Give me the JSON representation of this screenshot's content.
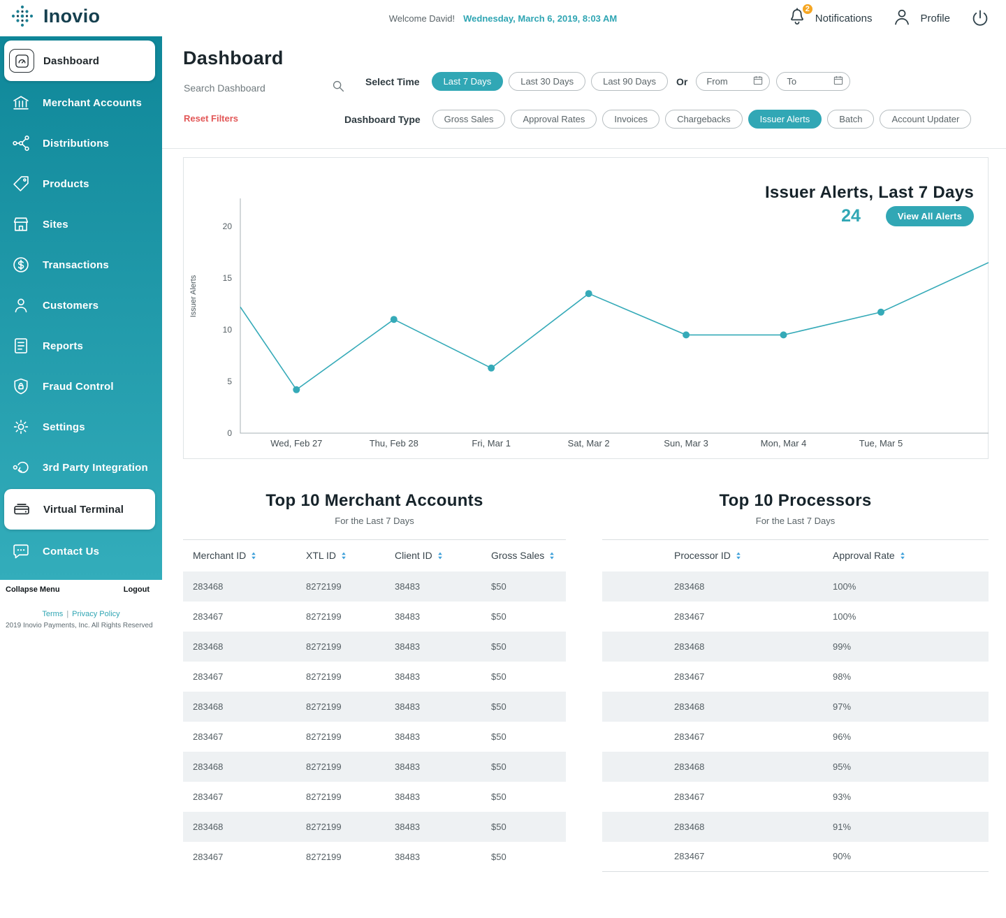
{
  "topbar": {
    "brand": "Inovio",
    "welcome": "Welcome David!",
    "datetime": "Wednesday, March 6, 2019, 8:03 AM",
    "notifications_label": "Notifications",
    "notifications_count": "2",
    "profile_label": "Profile"
  },
  "sidebar": {
    "items": [
      {
        "label": "Dashboard",
        "icon": "dashboard-icon",
        "active": true
      },
      {
        "label": "Merchant Accounts",
        "icon": "merchant-accounts-icon",
        "active": false
      },
      {
        "label": "Distributions",
        "icon": "distributions-icon",
        "active": false
      },
      {
        "label": "Products",
        "icon": "products-icon",
        "active": false
      },
      {
        "label": "Sites",
        "icon": "sites-icon",
        "active": false
      },
      {
        "label": "Transactions",
        "icon": "transactions-icon",
        "active": false
      },
      {
        "label": "Customers",
        "icon": "customers-icon",
        "active": false
      },
      {
        "label": "Reports",
        "icon": "reports-icon",
        "active": false
      },
      {
        "label": "Fraud Control",
        "icon": "fraud-control-icon",
        "active": false
      },
      {
        "label": "Settings",
        "icon": "settings-icon",
        "active": false
      },
      {
        "label": "3rd Party Integration",
        "icon": "integration-icon",
        "active": false
      },
      {
        "label": "Virtual Terminal",
        "icon": "virtual-terminal-icon",
        "active": true
      },
      {
        "label": "Contact Us",
        "icon": "contact-icon",
        "active": false
      }
    ],
    "collapse_label": "Collapse Menu",
    "logout_label": "Logout",
    "terms_label": "Terms",
    "privacy_label": "Privacy Policy",
    "copyright": "2019 Inovio Payments, Inc. All Rights Reserved"
  },
  "filters": {
    "page_title": "Dashboard",
    "search_placeholder": "Search Dashboard",
    "select_time_label": "Select Time",
    "time_options": [
      "Last 7 Days",
      "Last 30 Days",
      "Last 90 Days"
    ],
    "active_time": "Last 7 Days",
    "or_label": "Or",
    "from_label": "From",
    "to_label": "To",
    "reset_label": "Reset Filters",
    "dashboard_type_label": "Dashboard Type",
    "type_options": [
      "Gross Sales",
      "Approval Rates",
      "Invoices",
      "Chargebacks",
      "Issuer Alerts",
      "Batch",
      "Account Updater"
    ],
    "active_type": "Issuer Alerts"
  },
  "chart_card": {
    "title": "Issuer Alerts, Last 7 Days",
    "total": "24",
    "view_all_label": "View All Alerts"
  },
  "chart_data": {
    "type": "line",
    "title": "Issuer Alerts, Last 7 Days",
    "ylabel": "Issuer Alerts",
    "categories": [
      "Wed, Feb 27",
      "Thu, Feb 28",
      "Fri, Mar 1",
      "Sat, Mar 2",
      "Sun, Mar 3",
      "Mon, Mar 4",
      "Tue, Mar 5"
    ],
    "values": [
      4.2,
      11,
      6.3,
      13.5,
      9.5,
      9.5,
      11.7
    ],
    "edge_start_value": 12.2,
    "edge_end_value": 16.5,
    "ylim": [
      0,
      20
    ],
    "yticks": [
      0,
      5,
      10,
      15,
      20
    ],
    "grid": false,
    "legend": false,
    "line_color": "#35aab8"
  },
  "tables": {
    "merchants": {
      "title": "Top 10 Merchant Accounts",
      "subtitle": "For the Last 7 Days",
      "columns": [
        "Merchant ID",
        "XTL ID",
        "Client ID",
        "Gross Sales"
      ],
      "rows": [
        [
          "283468",
          "8272199",
          "38483",
          "$50"
        ],
        [
          "283467",
          "8272199",
          "38483",
          "$50"
        ],
        [
          "283468",
          "8272199",
          "38483",
          "$50"
        ],
        [
          "283467",
          "8272199",
          "38483",
          "$50"
        ],
        [
          "283468",
          "8272199",
          "38483",
          "$50"
        ],
        [
          "283467",
          "8272199",
          "38483",
          "$50"
        ],
        [
          "283468",
          "8272199",
          "38483",
          "$50"
        ],
        [
          "283467",
          "8272199",
          "38483",
          "$50"
        ],
        [
          "283468",
          "8272199",
          "38483",
          "$50"
        ],
        [
          "283467",
          "8272199",
          "38483",
          "$50"
        ]
      ]
    },
    "processors": {
      "title": "Top 10 Processors",
      "subtitle": "For the Last 7 Days",
      "columns": [
        "Processor ID",
        "Approval Rate"
      ],
      "rows": [
        [
          "283468",
          "100%"
        ],
        [
          "283467",
          "100%"
        ],
        [
          "283468",
          "99%"
        ],
        [
          "283467",
          "98%"
        ],
        [
          "283468",
          "97%"
        ],
        [
          "283467",
          "96%"
        ],
        [
          "283468",
          "95%"
        ],
        [
          "283467",
          "93%"
        ],
        [
          "283468",
          "91%"
        ],
        [
          "283467",
          "90%"
        ]
      ]
    }
  },
  "colors": {
    "accent": "#31a7b5",
    "badge": "#f5a623",
    "reset": "#e25757",
    "stripe": "#eef1f3",
    "sort_arrow": "#3fa0d9"
  }
}
